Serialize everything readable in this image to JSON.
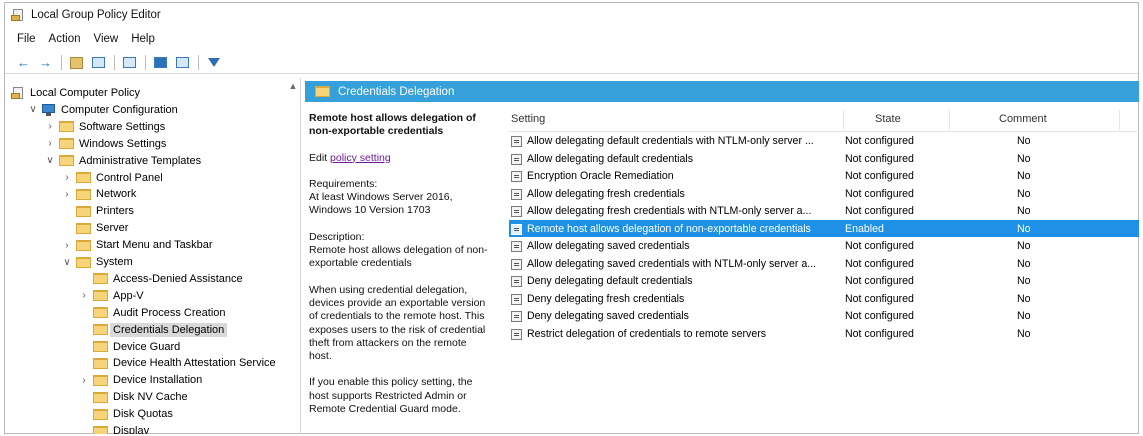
{
  "window": {
    "title": "Local Group Policy Editor"
  },
  "menu": [
    "File",
    "Action",
    "View",
    "Help"
  ],
  "tree": [
    {
      "label": "Local Computer Policy",
      "icon": "policy-icon",
      "indent": 0,
      "chevron": ""
    },
    {
      "label": "Computer Configuration",
      "icon": "computer-icon",
      "indent": 1,
      "chevron": "v"
    },
    {
      "label": "Software Settings",
      "icon": "folder-icon",
      "indent": 2,
      "chevron": ">"
    },
    {
      "label": "Windows Settings",
      "icon": "folder-icon",
      "indent": 2,
      "chevron": ">"
    },
    {
      "label": "Administrative Templates",
      "icon": "folder-icon",
      "indent": 2,
      "chevron": "v"
    },
    {
      "label": "Control Panel",
      "icon": "folder-icon",
      "indent": 3,
      "chevron": ">"
    },
    {
      "label": "Network",
      "icon": "folder-icon",
      "indent": 3,
      "chevron": ">"
    },
    {
      "label": "Printers",
      "icon": "folder-icon",
      "indent": 3,
      "chevron": ""
    },
    {
      "label": "Server",
      "icon": "folder-icon",
      "indent": 3,
      "chevron": ""
    },
    {
      "label": "Start Menu and Taskbar",
      "icon": "folder-icon",
      "indent": 3,
      "chevron": ">"
    },
    {
      "label": "System",
      "icon": "folder-icon",
      "indent": 3,
      "chevron": "v"
    },
    {
      "label": "Access-Denied Assistance",
      "icon": "folder-icon",
      "indent": 4,
      "chevron": ""
    },
    {
      "label": "App-V",
      "icon": "folder-icon",
      "indent": 4,
      "chevron": ">"
    },
    {
      "label": "Audit Process Creation",
      "icon": "folder-icon",
      "indent": 4,
      "chevron": ""
    },
    {
      "label": "Credentials Delegation",
      "icon": "folder-icon",
      "indent": 4,
      "chevron": "",
      "selected": true
    },
    {
      "label": "Device Guard",
      "icon": "folder-icon",
      "indent": 4,
      "chevron": ""
    },
    {
      "label": "Device Health Attestation Service",
      "icon": "folder-icon",
      "indent": 4,
      "chevron": ""
    },
    {
      "label": "Device Installation",
      "icon": "folder-icon",
      "indent": 4,
      "chevron": ">"
    },
    {
      "label": "Disk NV Cache",
      "icon": "folder-icon",
      "indent": 4,
      "chevron": ""
    },
    {
      "label": "Disk Quotas",
      "icon": "folder-icon",
      "indent": 4,
      "chevron": ""
    },
    {
      "label": "Display",
      "icon": "folder-icon",
      "indent": 4,
      "chevron": ""
    }
  ],
  "detail": {
    "header": "Credentials Delegation",
    "description": {
      "heading": "Remote host allows delegation of non-exportable credentials",
      "edit_prefix": "Edit ",
      "edit_link": "policy setting",
      "requirements_label": "Requirements:",
      "requirements": "At least Windows Server 2016, Windows 10 Version 1703",
      "description_label": "Description:",
      "description": "Remote host allows delegation of non-exportable credentials",
      "para1": "When using credential delegation, devices provide an exportable version of credentials to the remote host. This exposes users to the risk of credential theft from attackers on the remote host.",
      "para2": "If you enable this policy setting, the host supports Restricted Admin or Remote Credential Guard mode."
    },
    "columns": {
      "setting": "Setting",
      "state": "State",
      "comment": "Comment"
    },
    "rows": [
      {
        "setting": "Allow delegating default credentials with NTLM-only server ...",
        "state": "Not configured",
        "comment": "No"
      },
      {
        "setting": "Allow delegating default credentials",
        "state": "Not configured",
        "comment": "No"
      },
      {
        "setting": "Encryption Oracle Remediation",
        "state": "Not configured",
        "comment": "No"
      },
      {
        "setting": "Allow delegating fresh credentials",
        "state": "Not configured",
        "comment": "No"
      },
      {
        "setting": "Allow delegating fresh credentials with NTLM-only server a...",
        "state": "Not configured",
        "comment": "No"
      },
      {
        "setting": "Remote host allows delegation of non-exportable credentials",
        "state": "Enabled",
        "comment": "No",
        "selected": true
      },
      {
        "setting": "Allow delegating saved credentials",
        "state": "Not configured",
        "comment": "No"
      },
      {
        "setting": "Allow delegating saved credentials with NTLM-only server a...",
        "state": "Not configured",
        "comment": "No"
      },
      {
        "setting": "Deny delegating default credentials",
        "state": "Not configured",
        "comment": "No"
      },
      {
        "setting": "Deny delegating fresh credentials",
        "state": "Not configured",
        "comment": "No"
      },
      {
        "setting": "Deny delegating saved credentials",
        "state": "Not configured",
        "comment": "No"
      },
      {
        "setting": "Restrict delegation of credentials to remote servers",
        "state": "Not configured",
        "comment": "No"
      }
    ]
  },
  "colors": {
    "header_blue": "#36a0da",
    "selection_blue": "#1e90e6",
    "folder_yellow": "#f5d47a"
  }
}
